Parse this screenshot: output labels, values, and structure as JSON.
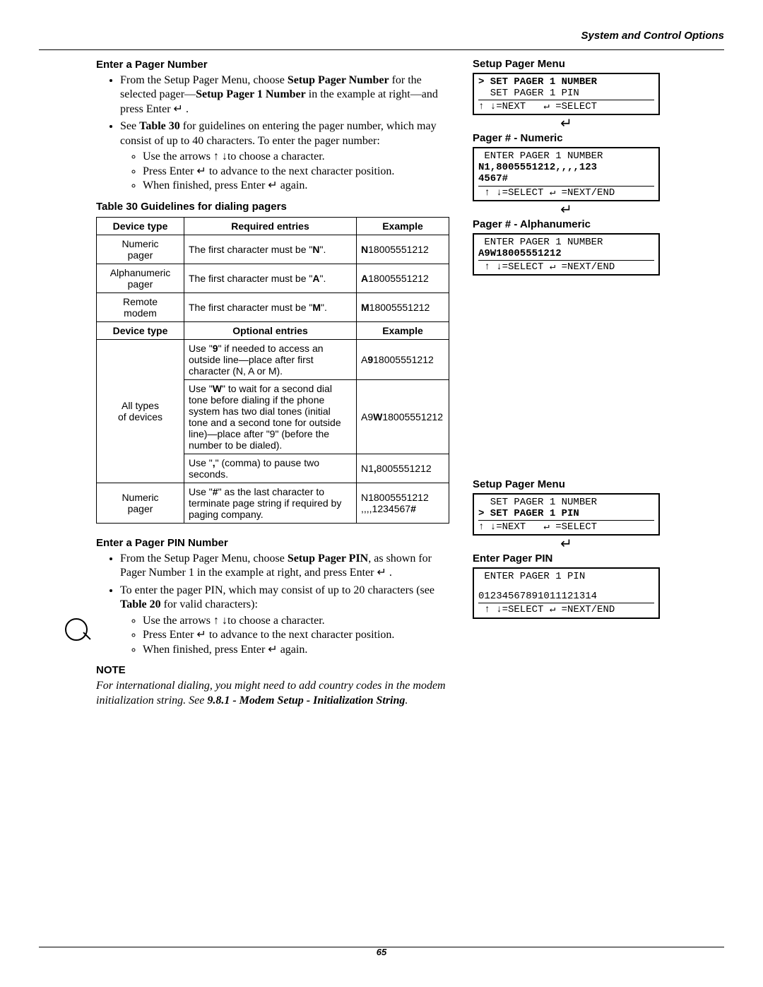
{
  "header": {
    "title": "System and Control Options"
  },
  "page_number": "65",
  "section1": {
    "title": "Enter a Pager Number",
    "bullets": {
      "p1_a": "From the Setup Pager Menu, choose ",
      "p1_b": "Setup Pager Number",
      "p1_c": " for the selected pager—",
      "p1_d": "Setup Pager 1 Number",
      "p1_e": " in the example at right—and press Enter ↵ .",
      "p2_a": "See ",
      "p2_b": "Table 30",
      "p2_c": " for guidelines on entering the pager number, which may consist of up to 40 characters. To enter the pager number:",
      "s1": "Use the arrows ↑ ↓to choose a character.",
      "s2": "Press Enter ↵ to advance to the next character position.",
      "s3": "When finished, press Enter ↵ again."
    },
    "table_caption": "Table 30    Guidelines for dialing pagers",
    "table": {
      "h1": "Device type",
      "h2": "Required entries",
      "h3": "Example",
      "r1c1": "Numeric\npager",
      "r1c2a": "The first character must be \"",
      "r1c2b": "N",
      "r1c2c": "\".",
      "r1c3b": "N",
      "r1c3r": "18005551212",
      "r2c1": "Alphanumeric\npager",
      "r2c2a": "The first character must be \"",
      "r2c2b": "A",
      "r2c2c": "\".",
      "r2c3b": "A",
      "r2c3r": "18005551212",
      "r3c1": "Remote\nmodem",
      "r3c2a": "The first character must be \"",
      "r3c2b": "M",
      "r3c2c": "\".",
      "r3c3b": "M",
      "r3c3r": "18005551212",
      "h4": "Device type",
      "h5": "Optional entries",
      "h6": "Example",
      "r4c1": "All types\nof devices",
      "r4c2a": "Use \"",
      "r4c2b": "9",
      "r4c2c": "\" if needed to access an outside line—place after first character (N, A or M).",
      "r4c3a": "A",
      "r4c3b": "9",
      "r4c3c": "18005551212",
      "r5c2a": "Use \"",
      "r5c2b": "W",
      "r5c2c": "\" to wait for a second dial tone before dialing if the phone system has two dial tones (initial tone and a second tone for outside line)—place after \"9\" (before the number to be dialed).",
      "r5c3a": "A9",
      "r5c3b": "W",
      "r5c3c": "18005551212",
      "r6c2a": "Use \"",
      "r6c2b": ",",
      "r6c2c": "\" (comma) to pause two seconds.",
      "r6c3a": "N1",
      "r6c3b": ",",
      "r6c3c": "8005551212",
      "r7c1": "Numeric\npager",
      "r7c2a": "Use \"",
      "r7c2b": "#",
      "r7c2c": "\" as the last character to terminate page string if required by paging company.",
      "r7c3l1a": "N18005551212",
      "r7c3l2a": ",,,,1234567",
      "r7c3l2b": "#"
    }
  },
  "section2": {
    "title": "Enter a Pager PIN Number",
    "p1a": "From the Setup Pager Menu, choose ",
    "p1b": "Setup Pager PIN",
    "p1c": ", as shown for Pager Number 1 in the example at right, and press Enter ↵ .",
    "p2a": "To enter the pager PIN, which may consist of up to 20 characters (see ",
    "p2b": "Table 20",
    "p2c": " for valid characters):",
    "s1": "Use the arrows ↑ ↓to choose a character.",
    "s2": "Press Enter ↵ to advance to the next character position.",
    "s3": "When finished, press Enter ↵ again."
  },
  "note": {
    "label": "NOTE",
    "body_a": "For international dialing, you might need to add country codes in the modem initialization string. See ",
    "body_b": "9.8.1 - Modem Setup - Initialization String",
    "body_c": "."
  },
  "side": {
    "t1": "Setup Pager Menu",
    "s1_l1": "> SET PAGER 1 NUMBER",
    "s1_l2": "  SET PAGER 1 PIN",
    "s1_nav": "↑ ↓=NEXT   ↵ =SELECT",
    "arrow": "↵",
    "t2": "Pager # - Numeric",
    "s2_l1": " ENTER PAGER 1 NUMBER",
    "s2_l2": "N1,8005551212,,,,123\n4567#",
    "s2_nav": " ↑ ↓=SELECT ↵ =NEXT/END",
    "t3": "Pager # - Alphanumeric",
    "s3_l1": " ENTER PAGER 1 NUMBER",
    "s3_l2": "A9W18005551212",
    "s3_nav": " ↑ ↓=SELECT ↵ =NEXT/END",
    "t4": "Setup Pager Menu",
    "s4_l1": "  SET PAGER 1 NUMBER",
    "s4_l2": "> SET PAGER 1 PIN",
    "s4_nav": "↑ ↓=NEXT   ↵ =SELECT",
    "t5": "Enter Pager PIN",
    "s5_l1": " ENTER PAGER 1 PIN",
    "s5_l2": "01234567891011121314",
    "s5_nav": " ↑ ↓=SELECT ↵ =NEXT/END"
  }
}
